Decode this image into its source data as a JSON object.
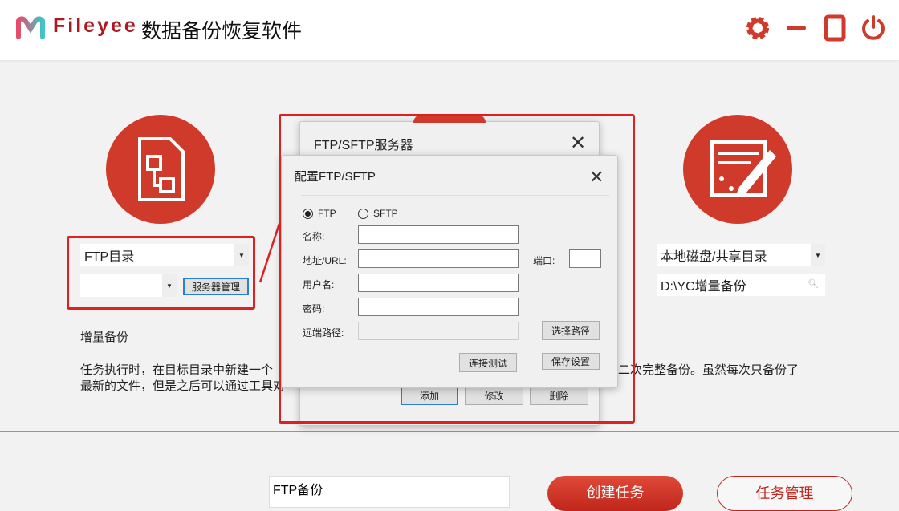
{
  "header": {
    "brand": "Fileyee",
    "title": "数据备份恢复软件",
    "icons": [
      "gear-icon",
      "minimize-icon",
      "maximize-icon",
      "power-icon"
    ],
    "accent": "#d03a2a"
  },
  "source": {
    "type_select": "FTP目录",
    "server_select": "",
    "server_manage_button": "服务器管理"
  },
  "target": {
    "type_select": "本地磁盘/共享目录",
    "path_value": "D:\\YC增量备份"
  },
  "mode": {
    "title": "增量备份",
    "desc_line1_a": "任务执行时，在目标目录中新建一个",
    "desc_line1_b": "二次完整备份。虽然每次只备份了",
    "desc_line2": "最新的文件，但是之后可以通过工具对"
  },
  "server_dialog": {
    "title": "FTP/SFTP服务器",
    "add": "添加",
    "edit": "修改",
    "delete": "删除"
  },
  "config_dialog": {
    "title": "配置FTP/SFTP",
    "radio_ftp": "FTP",
    "radio_sftp": "SFTP",
    "selected": "FTP",
    "name_label": "名称:",
    "url_label": "地址/URL:",
    "port_label": "端口:",
    "user_label": "用户名:",
    "password_label": "密码:",
    "remote_label": "远端路径:",
    "name_value": "",
    "url_value": "",
    "port_value": "",
    "user_value": "",
    "password_value": "",
    "remote_value": "",
    "choose_path": "选择路径",
    "test_connection": "连接测试",
    "save": "保存设置"
  },
  "footer": {
    "task_name": "FTP备份",
    "create_task": "创建任务",
    "task_manage": "任务管理"
  }
}
